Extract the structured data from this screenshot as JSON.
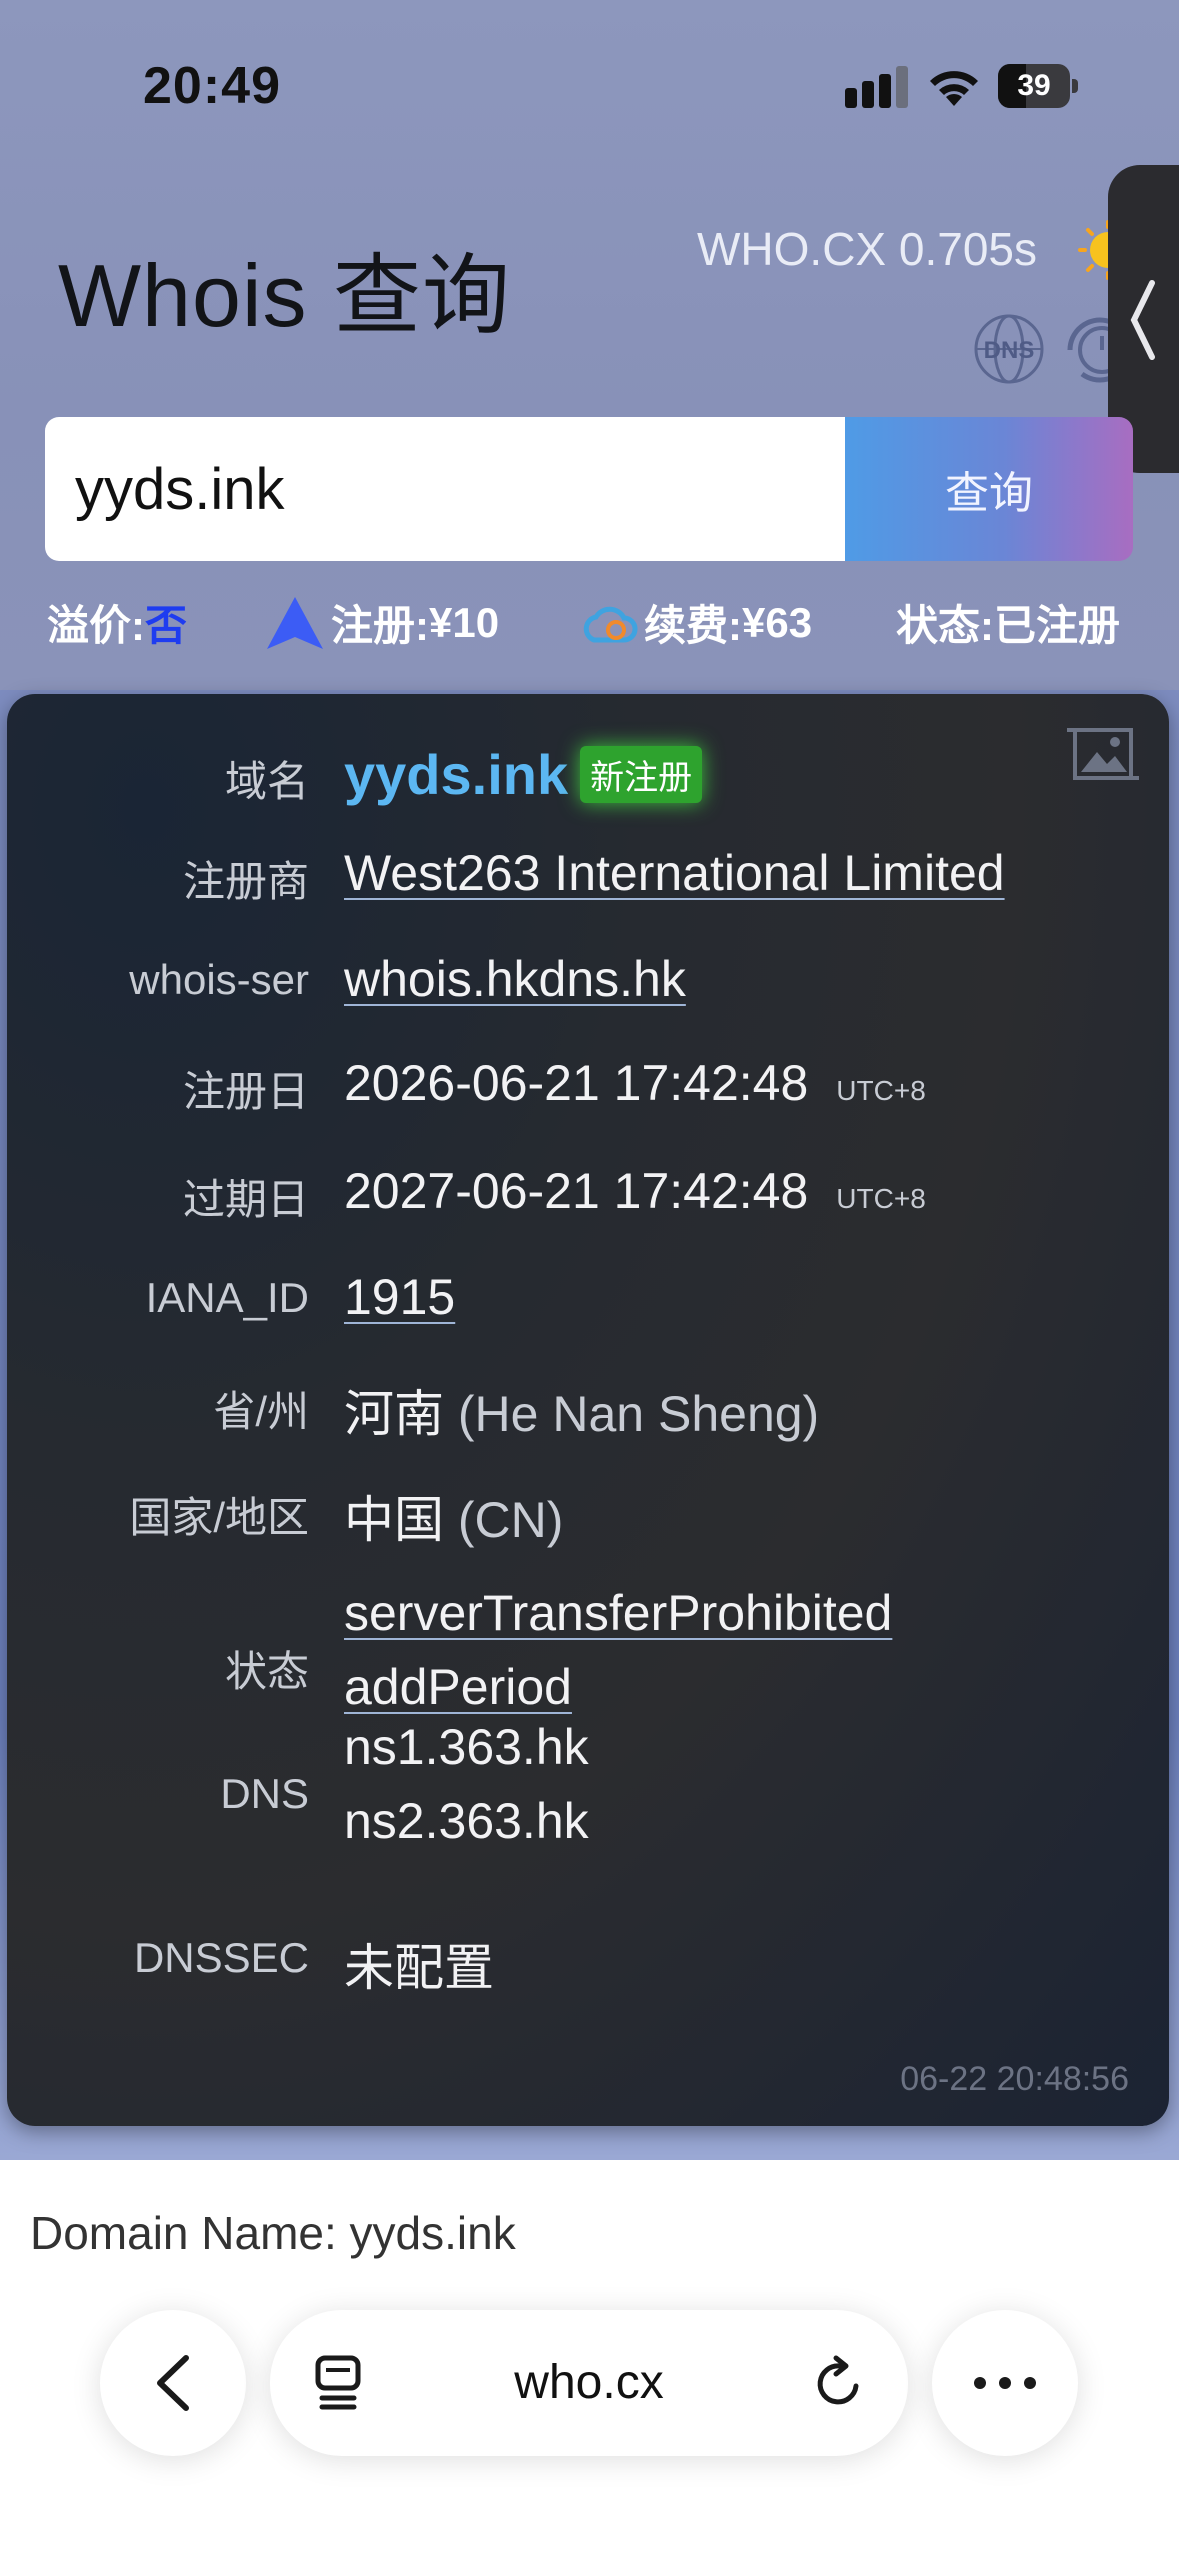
{
  "status_bar": {
    "time": "20:49",
    "battery": "39",
    "battery_level": 0.39
  },
  "header": {
    "title": "Whois 查询",
    "speed": "WHO.CX 0.705s",
    "dns_icon_label": "DNS"
  },
  "search": {
    "value": "yyds.ink",
    "button_label": "查询"
  },
  "prices": {
    "premium_label": "溢价:",
    "premium_value": "否",
    "register_label": "注册:",
    "register_value": "¥10",
    "renew_label": "续费:",
    "renew_value": "¥63",
    "status_label": "状态:",
    "status_value": "已注册"
  },
  "whois": {
    "domain_label": "域名",
    "domain": "yyds.ink",
    "domain_badge": "新注册",
    "registrar_label": "注册商",
    "registrar": "West263 International Limited",
    "whois_server_label": "whois-ser",
    "whois_server": "whois.hkdns.hk",
    "created_label": "注册日",
    "created": "2026-06-21 17:42:48",
    "created_tz": "UTC+8",
    "expires_label": "过期日",
    "expires": "2027-06-21 17:42:48",
    "expires_tz": "UTC+8",
    "iana_label": "IANA_ID",
    "iana_id": "1915",
    "province_label": "省/州",
    "province": "河南",
    "province_en": "(He Nan Sheng)",
    "country_label": "国家/地区",
    "country": "中国",
    "country_code": "(CN)",
    "status_label": "状态",
    "status": [
      "serverTransferProhibited",
      "addPeriod"
    ],
    "dns_label": "DNS",
    "dns": [
      "ns1.363.hk",
      "ns2.363.hk"
    ],
    "dnssec_label": "DNSSEC",
    "dnssec": "未配置",
    "queried_at": "06-22 20:48:56"
  },
  "raw": {
    "first_line": "Domain Name: yyds.ink"
  },
  "browser": {
    "url": "who.cx"
  },
  "colors": {
    "accent_blue": "#5cb7f2",
    "badge_green": "#2ea32e",
    "premium_blue": "#1e3cf0"
  }
}
